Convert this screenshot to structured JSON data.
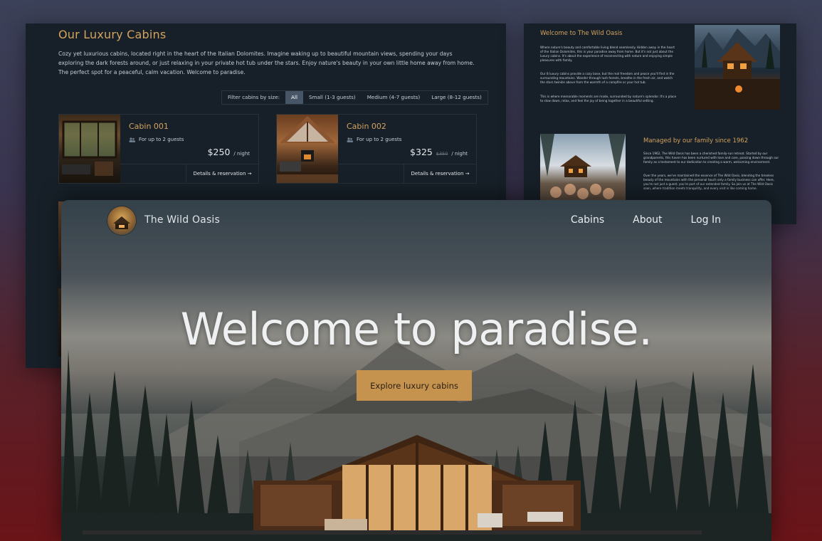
{
  "cabins_page": {
    "title": "Our Luxury Cabins",
    "intro": "Cozy yet luxurious cabins, located right in the heart of the Italian Dolomites. Imagine waking up to beautiful mountain views, spending your days exploring the dark forests around, or just relaxing in your private hot tub under the stars. Enjoy nature's beauty in your own little home away from home. The perfect spot for a peaceful, calm vacation. Welcome to paradise.",
    "filter": {
      "label": "Filter cabins by size:",
      "options": [
        "All",
        "Small (1-3 guests)",
        "Medium (4-7 guests)",
        "Large (8-12 guests)"
      ],
      "selected": "All"
    },
    "cards": [
      {
        "name": "Cabin 001",
        "guests": "For up to 2 guests",
        "price": "$250",
        "old_price": "",
        "per_night": "/ night",
        "details": "Details & reservation →"
      },
      {
        "name": "Cabin 002",
        "guests": "For up to 2 guests",
        "price": "$325",
        "old_price": "$350",
        "per_night": "/ night",
        "details": "Details & reservation →"
      }
    ]
  },
  "about_page": {
    "welcome_title": "Welcome to The Wild Oasis",
    "p1": "Where nature's beauty and comfortable living blend seamlessly. Hidden away in the heart of the Italian Dolomites, this is your paradise away from home. But it's not just about the luxury cabins. It's about the experience of reconnecting with nature and enjoying simple pleasures with family.",
    "p2": "Our 8 luxury cabins provide a cozy base, but the real freedom and peace you'll find in the surrounding mountains. Wander through lush forests, breathe in the fresh air, and watch the stars twinkle above from the warmth of a campfire or your hot tub.",
    "p3": "This is where memorable moments are made, surrounded by nature's splendor. It's a place to slow down, relax, and feel the joy of being together in a beautiful setting.",
    "family_title": "Managed by our family since 1962",
    "p4": "Since 1962, The Wild Oasis has been a cherished family-run retreat. Started by our grandparents, this haven has been nurtured with love and care, passing down through our family as a testament to our dedication to creating a warm, welcoming environment.",
    "p5": "Over the years, we've maintained the essence of The Wild Oasis, blending the timeless beauty of the mountains with the personal touch only a family business can offer. Here, you're not just a guest; you're part of our extended family. So join us at The Wild Oasis soon, where tradition meets tranquility, and every visit is like coming home."
  },
  "hero_page": {
    "brand": "The Wild Oasis",
    "nav": [
      "Cabins",
      "About",
      "Log In"
    ],
    "headline": "Welcome to paradise.",
    "cta": "Explore luxury cabins"
  },
  "colors": {
    "accent": "#d3a35f",
    "cta_bg": "#c6934f",
    "panel_bg": "#172028"
  },
  "icons": {
    "guests": "users-icon",
    "logo": "logo-icon"
  }
}
